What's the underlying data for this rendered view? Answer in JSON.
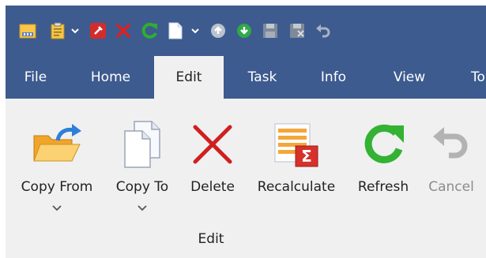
{
  "qat": {
    "buttons": [
      {
        "icon": "folder-grid-icon"
      },
      {
        "icon": "clipboard-icon"
      },
      {
        "icon": "red-square-icon"
      },
      {
        "icon": "red-x-icon"
      },
      {
        "icon": "refresh-green-icon"
      },
      {
        "icon": "blank-page-icon"
      },
      {
        "icon": "up-arrow-circle-icon"
      },
      {
        "icon": "down-arrow-circle-icon"
      },
      {
        "icon": "save-disk-icon"
      },
      {
        "icon": "save-disk-x-icon"
      },
      {
        "icon": "undo-icon"
      }
    ]
  },
  "tabs": [
    {
      "label": "File"
    },
    {
      "label": "Home"
    },
    {
      "label": "Edit",
      "active": true
    },
    {
      "label": "Task"
    },
    {
      "label": "Info"
    },
    {
      "label": "View"
    },
    {
      "label": "To"
    }
  ],
  "ribbon": {
    "group_label": "Edit",
    "buttons": [
      {
        "label": "Copy From",
        "icon": "folder-open-arrow-icon",
        "has_dropdown": true
      },
      {
        "label": "Copy To",
        "icon": "copy-pages-icon",
        "has_dropdown": true
      },
      {
        "label": "Delete",
        "icon": "delete-x-icon"
      },
      {
        "label": "Recalculate",
        "icon": "recalculate-sigma-icon"
      },
      {
        "label": "Refresh",
        "icon": "refresh-icon"
      },
      {
        "label": "Cancel",
        "icon": "undo-cancel-icon",
        "disabled": true
      }
    ]
  },
  "colors": {
    "header_blue": "#3d5b8f",
    "ribbon_bg": "#f0f0f0",
    "disabled_text": "#8c8c8c"
  }
}
